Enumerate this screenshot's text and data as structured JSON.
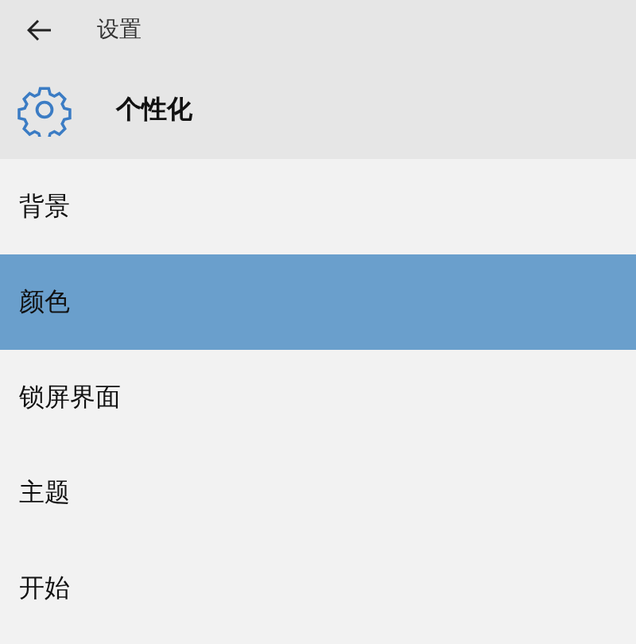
{
  "window": {
    "title": "设置"
  },
  "page": {
    "title": "个性化"
  },
  "menu": [
    {
      "label": "背景",
      "selected": false
    },
    {
      "label": "颜色",
      "selected": true
    },
    {
      "label": "锁屏界面",
      "selected": false
    },
    {
      "label": "主题",
      "selected": false
    },
    {
      "label": "开始",
      "selected": false
    }
  ]
}
